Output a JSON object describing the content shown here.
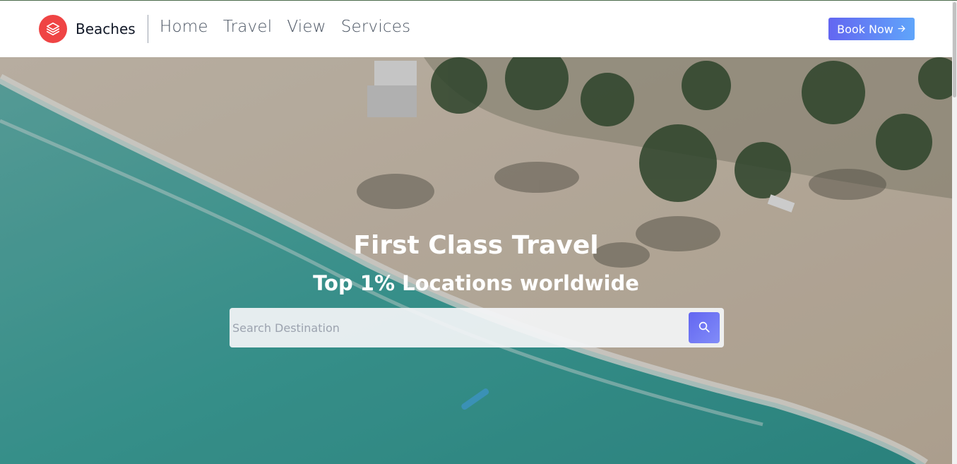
{
  "brand": {
    "name": "Beaches",
    "logo_icon": "layers-icon",
    "logo_color": "#ef4444"
  },
  "nav": {
    "items": [
      {
        "label": "Home"
      },
      {
        "label": "Travel"
      },
      {
        "label": "View"
      },
      {
        "label": "Services"
      }
    ],
    "cta": {
      "label": "Book Now",
      "icon": "arrow-right-icon"
    }
  },
  "hero": {
    "title": "First Class Travel",
    "subtitle": "Top 1% Locations worldwide",
    "search": {
      "placeholder": "Search Destination",
      "value": "",
      "icon": "search-icon"
    }
  },
  "colors": {
    "accent": "#6366f1",
    "accent_light": "#60a5fa"
  }
}
